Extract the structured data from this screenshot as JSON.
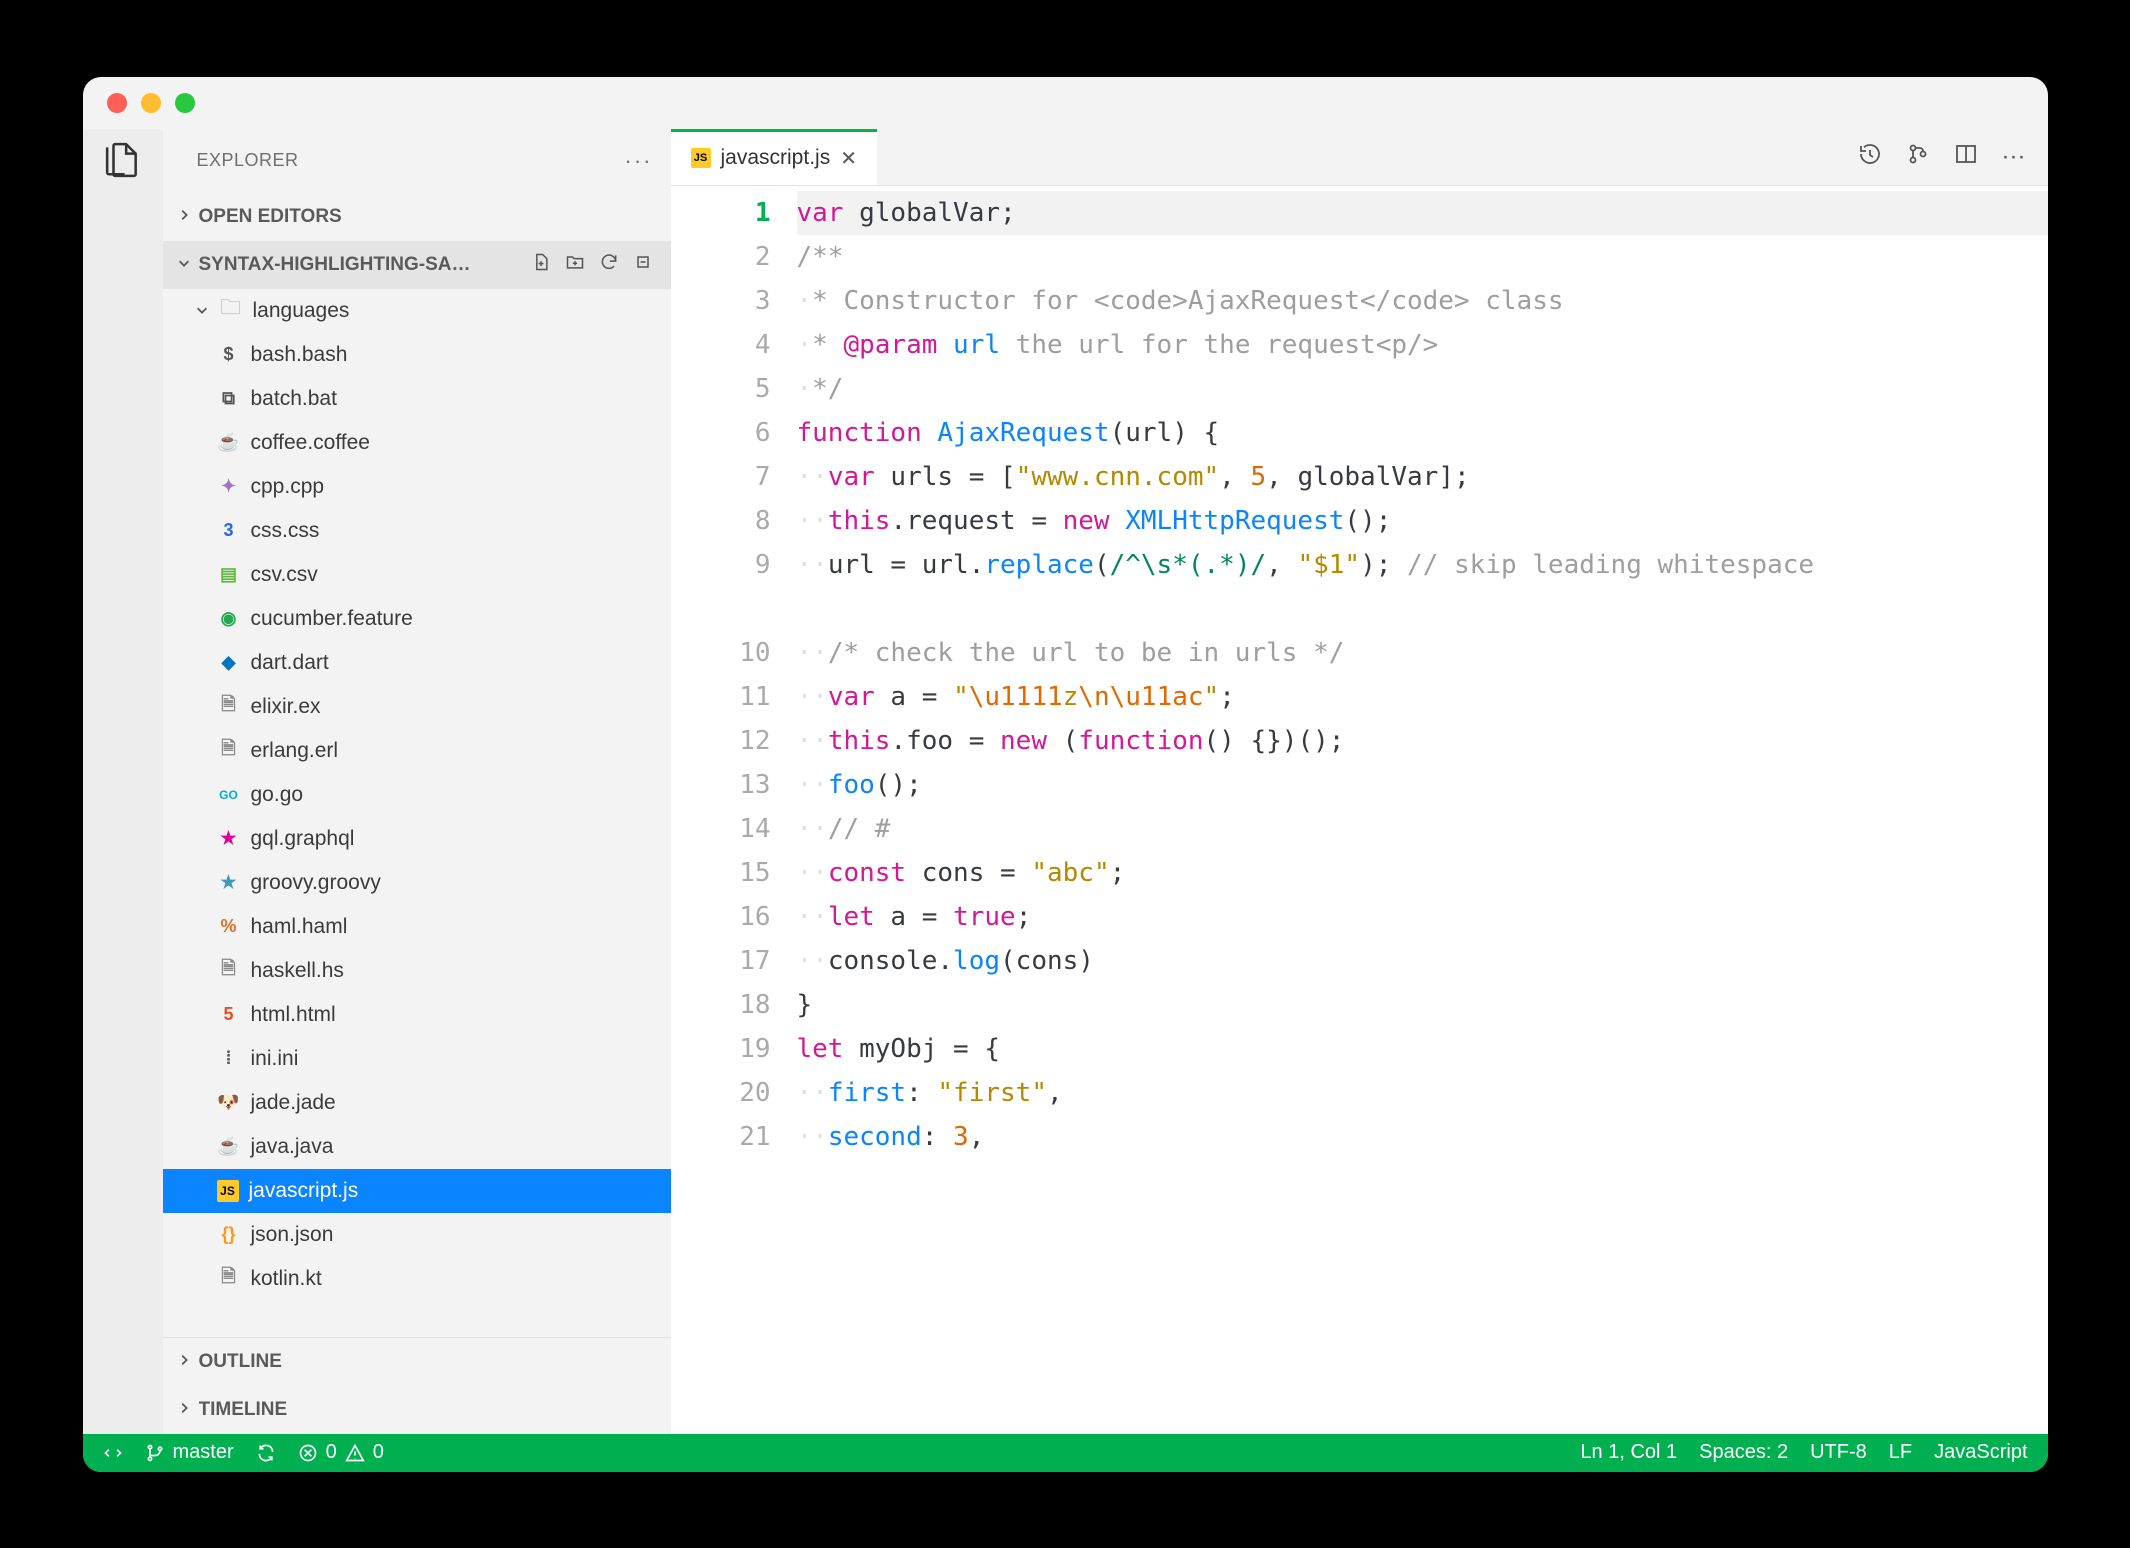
{
  "sidebar": {
    "title": "EXPLORER",
    "sections": {
      "open_editors": "OPEN EDITORS",
      "root": "SYNTAX-HIGHLIGHTING-SA…",
      "outline": "OUTLINE",
      "timeline": "TIMELINE"
    },
    "folder": "languages",
    "files": [
      {
        "name": "bash.bash",
        "icon": "bash",
        "color": "#555"
      },
      {
        "name": "batch.bat",
        "icon": "bat",
        "color": "#555"
      },
      {
        "name": "coffee.coffee",
        "icon": "coffee",
        "color": "#6f4e37"
      },
      {
        "name": "cpp.cpp",
        "icon": "cpp",
        "color": "#a074c4"
      },
      {
        "name": "css.css",
        "icon": "css",
        "color": "#2965f1"
      },
      {
        "name": "csv.csv",
        "icon": "csv",
        "color": "#65b741"
      },
      {
        "name": "cucumber.feature",
        "icon": "cucumber",
        "color": "#23a84f"
      },
      {
        "name": "dart.dart",
        "icon": "dart",
        "color": "#0175c2"
      },
      {
        "name": "elixir.ex",
        "icon": "file",
        "color": "#888"
      },
      {
        "name": "erlang.erl",
        "icon": "file",
        "color": "#888"
      },
      {
        "name": "go.go",
        "icon": "go",
        "color": "#00add8"
      },
      {
        "name": "gql.graphql",
        "icon": "gql",
        "color": "#e10098"
      },
      {
        "name": "groovy.groovy",
        "icon": "groovy",
        "color": "#4298b8"
      },
      {
        "name": "haml.haml",
        "icon": "haml",
        "color": "#e16e27"
      },
      {
        "name": "haskell.hs",
        "icon": "file",
        "color": "#888"
      },
      {
        "name": "html.html",
        "icon": "html",
        "color": "#e44d26"
      },
      {
        "name": "ini.ini",
        "icon": "ini",
        "color": "#555"
      },
      {
        "name": "jade.jade",
        "icon": "jade",
        "color": "#a86454"
      },
      {
        "name": "java.java",
        "icon": "java",
        "color": "#f8981d"
      },
      {
        "name": "javascript.js",
        "icon": "js",
        "color": "#ffca28",
        "selected": true
      },
      {
        "name": "json.json",
        "icon": "json",
        "color": "#f8981d"
      },
      {
        "name": "kotlin.kt",
        "icon": "file",
        "color": "#888"
      }
    ]
  },
  "tab": {
    "filename": "javascript.js"
  },
  "code_lines": [
    [
      {
        "t": "var",
        "c": "kw"
      },
      {
        "t": " globalVar;",
        "c": "pn"
      }
    ],
    [
      {
        "t": "/**",
        "c": "cm"
      }
    ],
    [
      {
        "t": "·",
        "c": "ws"
      },
      {
        "t": "* Constructor for <code>AjaxRequest</code> class",
        "c": "cm"
      }
    ],
    [
      {
        "t": "·",
        "c": "ws"
      },
      {
        "t": "* ",
        "c": "cm"
      },
      {
        "t": "@param",
        "c": "cm-kw"
      },
      {
        "t": " ",
        "c": "cm"
      },
      {
        "t": "url",
        "c": "cm-var"
      },
      {
        "t": " the url for the request<p/>",
        "c": "cm"
      }
    ],
    [
      {
        "t": "·",
        "c": "ws"
      },
      {
        "t": "*/",
        "c": "cm"
      }
    ],
    [
      {
        "t": "function",
        "c": "kw"
      },
      {
        "t": " ",
        "c": "pn"
      },
      {
        "t": "AjaxRequest",
        "c": "fn"
      },
      {
        "t": "(url) {",
        "c": "pn"
      }
    ],
    [
      {
        "t": "··",
        "c": "ws"
      },
      {
        "t": "var",
        "c": "kw"
      },
      {
        "t": " urls = [",
        "c": "pn"
      },
      {
        "t": "\"www.cnn.com\"",
        "c": "str"
      },
      {
        "t": ", ",
        "c": "pn"
      },
      {
        "t": "5",
        "c": "num"
      },
      {
        "t": ", globalVar];",
        "c": "pn"
      }
    ],
    [
      {
        "t": "··",
        "c": "ws"
      },
      {
        "t": "this",
        "c": "kw"
      },
      {
        "t": ".request = ",
        "c": "pn"
      },
      {
        "t": "new",
        "c": "kw"
      },
      {
        "t": " ",
        "c": "pn"
      },
      {
        "t": "XMLHttpRequest",
        "c": "type"
      },
      {
        "t": "();",
        "c": "pn"
      }
    ],
    [
      {
        "t": "··",
        "c": "ws"
      },
      {
        "t": "url = url.",
        "c": "pn"
      },
      {
        "t": "replace",
        "c": "fn"
      },
      {
        "t": "(",
        "c": "pn"
      },
      {
        "t": "/^\\s*(.*)/",
        "c": "regex"
      },
      {
        "t": ", ",
        "c": "pn"
      },
      {
        "t": "\"$1\"",
        "c": "str"
      },
      {
        "t": "); ",
        "c": "pn"
      },
      {
        "t": "// skip leading whitespace",
        "c": "cm"
      }
    ],
    [
      {
        "t": "··",
        "c": "ws"
      },
      {
        "t": "/* check the url to be in urls */",
        "c": "cm"
      }
    ],
    [
      {
        "t": "··",
        "c": "ws"
      },
      {
        "t": "var",
        "c": "kw"
      },
      {
        "t": " a = ",
        "c": "pn"
      },
      {
        "t": "\"",
        "c": "str"
      },
      {
        "t": "\\u1111",
        "c": "esc"
      },
      {
        "t": "z",
        "c": "str"
      },
      {
        "t": "\\n\\u11ac",
        "c": "esc"
      },
      {
        "t": "\"",
        "c": "str"
      },
      {
        "t": ";",
        "c": "pn"
      }
    ],
    [
      {
        "t": "··",
        "c": "ws"
      },
      {
        "t": "this",
        "c": "kw"
      },
      {
        "t": ".foo = ",
        "c": "pn"
      },
      {
        "t": "new",
        "c": "kw"
      },
      {
        "t": " (",
        "c": "pn"
      },
      {
        "t": "function",
        "c": "kw"
      },
      {
        "t": "() {})();",
        "c": "pn"
      }
    ],
    [
      {
        "t": "··",
        "c": "ws"
      },
      {
        "t": "foo",
        "c": "fn"
      },
      {
        "t": "();",
        "c": "pn"
      }
    ],
    [
      {
        "t": "··",
        "c": "ws"
      },
      {
        "t": "// #",
        "c": "cm"
      }
    ],
    [
      {
        "t": "··",
        "c": "ws"
      },
      {
        "t": "const",
        "c": "kw"
      },
      {
        "t": " cons = ",
        "c": "pn"
      },
      {
        "t": "\"abc\"",
        "c": "str"
      },
      {
        "t": ";",
        "c": "pn"
      }
    ],
    [
      {
        "t": "··",
        "c": "ws"
      },
      {
        "t": "let",
        "c": "kw"
      },
      {
        "t": " a = ",
        "c": "pn"
      },
      {
        "t": "true",
        "c": "bool"
      },
      {
        "t": ";",
        "c": "pn"
      }
    ],
    [
      {
        "t": "··",
        "c": "ws"
      },
      {
        "t": "console.",
        "c": "pn"
      },
      {
        "t": "log",
        "c": "fn"
      },
      {
        "t": "(cons)",
        "c": "pn"
      }
    ],
    [
      {
        "t": "}",
        "c": "pn"
      }
    ],
    [
      {
        "t": "let",
        "c": "kw"
      },
      {
        "t": " myObj = {",
        "c": "pn"
      }
    ],
    [
      {
        "t": "··",
        "c": "ws"
      },
      {
        "t": "first",
        "c": "prop"
      },
      {
        "t": ": ",
        "c": "pn"
      },
      {
        "t": "\"first\"",
        "c": "str"
      },
      {
        "t": ",",
        "c": "pn"
      }
    ],
    [
      {
        "t": "··",
        "c": "ws"
      },
      {
        "t": "second",
        "c": "prop"
      },
      {
        "t": ": ",
        "c": "pn"
      },
      {
        "t": "3",
        "c": "num"
      },
      {
        "t": ",",
        "c": "pn"
      }
    ]
  ],
  "line_wrap": {
    "9": 2
  },
  "statusbar": {
    "branch": "master",
    "errors": "0",
    "warnings": "0",
    "cursor": "Ln 1, Col 1",
    "spaces": "Spaces: 2",
    "encoding": "UTF-8",
    "eol": "LF",
    "language": "JavaScript"
  }
}
